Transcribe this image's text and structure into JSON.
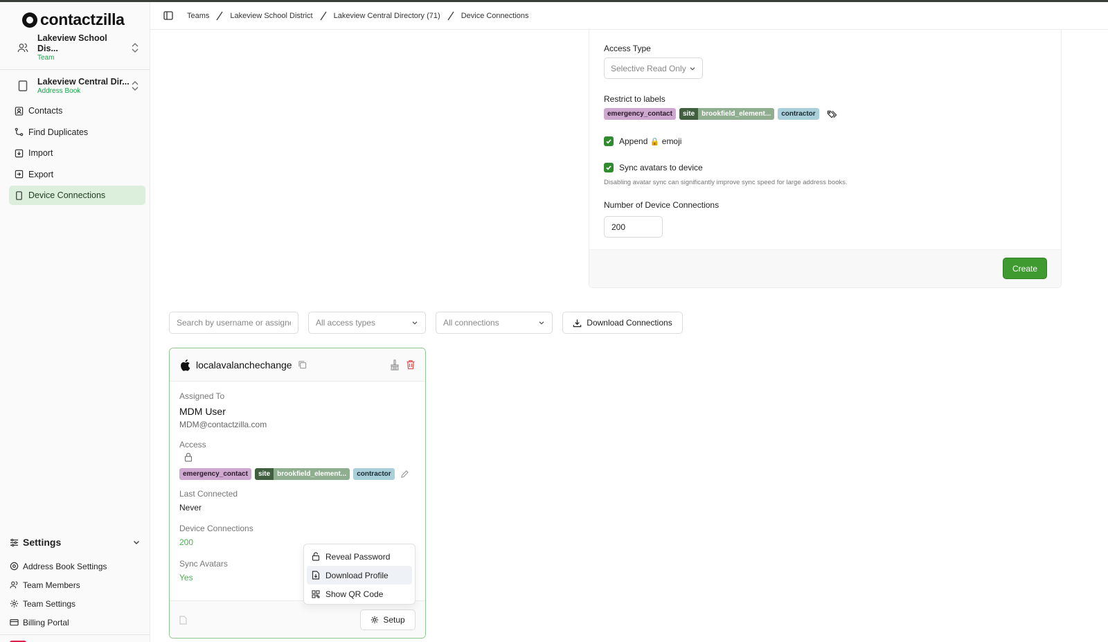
{
  "app": {
    "brand": "contactzilla"
  },
  "sidebar": {
    "team": {
      "title": "Lakeview School Dis...",
      "subtitle": "Team"
    },
    "book": {
      "title": "Lakeview Central Dir...",
      "subtitle": "Address Book"
    },
    "nav": [
      {
        "label": "Contacts",
        "icon": "contacts-icon"
      },
      {
        "label": "Find Duplicates",
        "icon": "merge-icon"
      },
      {
        "label": "Import",
        "icon": "import-icon"
      },
      {
        "label": "Export",
        "icon": "export-icon"
      },
      {
        "label": "Device Connections",
        "icon": "device-icon",
        "active": true
      }
    ],
    "settings": {
      "title": "Settings",
      "items": [
        {
          "label": "Address Book Settings"
        },
        {
          "label": "Team Members"
        },
        {
          "label": "Team Settings"
        },
        {
          "label": "Billing Portal"
        }
      ]
    }
  },
  "breadcrumb": [
    "Teams",
    "Lakeview School District",
    "Lakeview Central Directory (71)",
    "Device Connections"
  ],
  "form": {
    "access_type_label": "Access Type",
    "access_type_value": "Selective Read Only",
    "restrict_label": "Restrict to labels",
    "tags": {
      "t1": "emergency_contact",
      "site_key": "site",
      "site_val": "brookfield_element...",
      "t3": "contractor"
    },
    "append_pre": "Append",
    "append_emoji": "🔒",
    "append_post": "emoji",
    "sync_label": "Sync avatars to device",
    "sync_hint": "Disabling avatar sync can significantly improve sync speed for large address books.",
    "num_label": "Number of Device Connections",
    "num_value": "200",
    "create_label": "Create"
  },
  "filters": {
    "search_placeholder": "Search by username or assignee",
    "access_types": "All access types",
    "connections": "All connections",
    "download_label": "Download Connections"
  },
  "connection": {
    "username": "localavalanchechange",
    "assigned_label": "Assigned To",
    "assigned_name": "MDM User",
    "assigned_email": "MDM@contactzilla.com",
    "access_label": "Access",
    "last_label": "Last Connected",
    "last_value": "Never",
    "dc_label": "Device Connections",
    "dc_value": "200",
    "sync_label": "Sync Avatars",
    "sync_value": "Yes",
    "setup_label": "Setup"
  },
  "menu": {
    "reveal": "Reveal Password",
    "download": "Download Profile",
    "qr": "Show QR Code"
  },
  "colors": {
    "accent": "#3f9a2f",
    "active_nav": "#dcefdc",
    "green_text": "#4caf50",
    "danger": "#e11d48"
  }
}
